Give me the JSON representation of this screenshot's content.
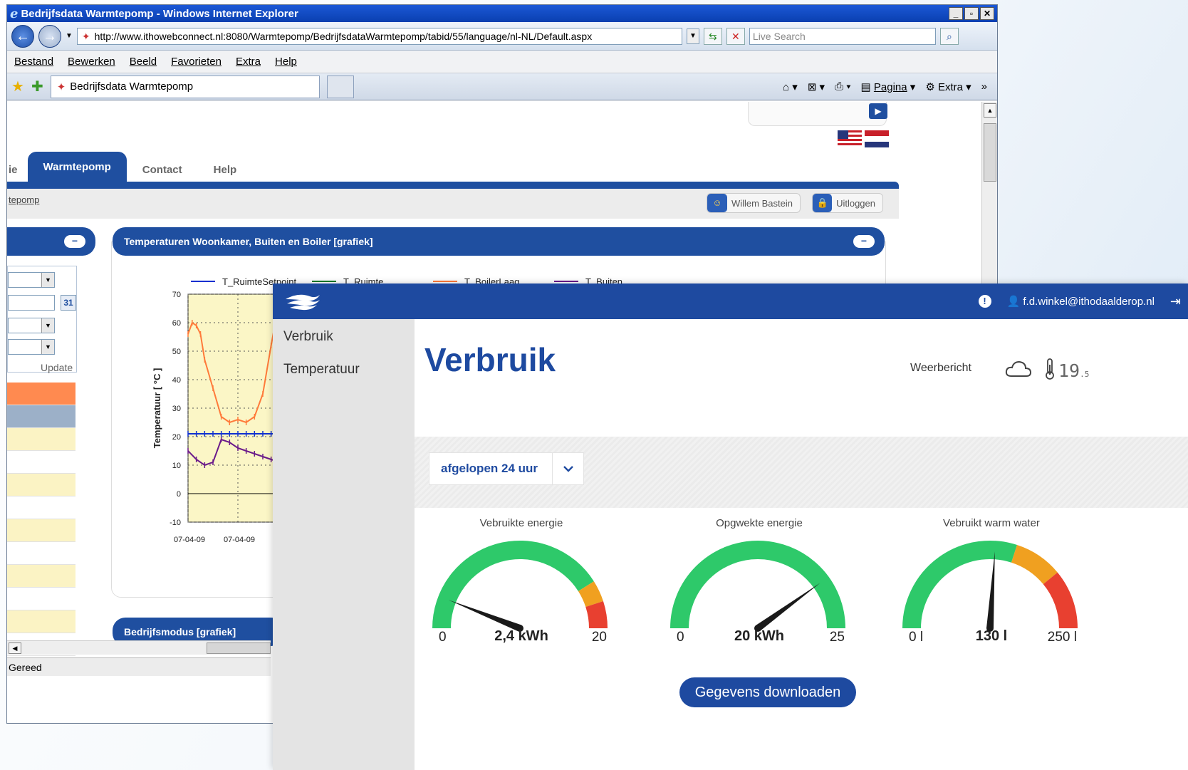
{
  "ie": {
    "title": "Bedrijfsdata Warmtepomp - Windows Internet Explorer",
    "url": "http://www.ithowebconnect.nl:8080/Warmtepomp/BedrijfsdataWarmtepomp/tabid/55/language/nl-NL/Default.aspx",
    "search_placeholder": "Live Search",
    "menu": [
      "Bestand",
      "Bewerken",
      "Beeld",
      "Favorieten",
      "Extra",
      "Help"
    ],
    "tab_title": "Bedrijfsdata Warmtepomp",
    "tools": {
      "page": "Pagina",
      "extra": "Extra"
    },
    "status": "Gereed"
  },
  "old_site": {
    "tabs": {
      "partial": "ie",
      "active": "Warmtepomp",
      "contact": "Contact",
      "help": "Help"
    },
    "breadcrumb": "tepomp",
    "user": "Willem Bastein",
    "logout": "Uitloggen",
    "panel_title": "Temperaturen Woonkamer, Buiten en Boiler [grafiek]",
    "panel2_title": "Bedrijfsmodus [grafiek]",
    "update": "Update",
    "cal_day": "31",
    "table_row_colors": [
      "#ff8a50",
      "#9cb0c8",
      "#fbf3c4",
      "#ffffff",
      "#fbf3c4",
      "#ffffff",
      "#fbf3c4",
      "#ffffff",
      "#fbf3c4",
      "#ffffff",
      "#fbf3c4",
      "#ffffff"
    ]
  },
  "chart_data": {
    "type": "line",
    "title": "",
    "ylabel": "Temperatuur [ °C ]",
    "xlabel": "",
    "ylim": [
      -10,
      70
    ],
    "yticks": [
      70,
      60,
      50,
      40,
      30,
      20,
      10,
      0,
      -10
    ],
    "xtick_labels": [
      "07-04-09",
      "07-04-09"
    ],
    "plot_bg": "#fbf6c6",
    "grid": "dotted",
    "legend": [
      "T_RuimteSetpoint",
      "T_Ruimte",
      "T_BoilerLaag",
      "T_Buiten"
    ],
    "series": [
      {
        "name": "T_RuimteSetpoint",
        "color": "#1030d0",
        "x": [
          0,
          1,
          2,
          3,
          4,
          5,
          6,
          7,
          8,
          9,
          10,
          11,
          12
        ],
        "y": [
          21,
          21,
          21,
          21,
          21,
          21,
          21,
          21,
          21,
          21,
          21,
          21,
          21
        ]
      },
      {
        "name": "T_BoilerLaag",
        "color": "#ff7a3a",
        "x": [
          0,
          0.5,
          1,
          1.5,
          2,
          3,
          4,
          5,
          6,
          7,
          8,
          9,
          10,
          10.5,
          11,
          11.5,
          12
        ],
        "y": [
          56,
          60,
          59,
          56,
          47,
          37,
          27,
          25,
          26,
          25,
          27,
          35,
          52,
          60,
          61,
          61,
          60
        ]
      },
      {
        "name": "T_Buiten",
        "color": "#6a1a8a",
        "x": [
          0,
          1,
          2,
          3,
          4,
          5,
          6,
          7,
          8,
          9,
          10,
          11,
          12
        ],
        "y": [
          15,
          12,
          10,
          11,
          19,
          18,
          16,
          15,
          14,
          13,
          12,
          11,
          10
        ]
      }
    ]
  },
  "app": {
    "user_email": "f.d.winkel@ithodaalderop.nl",
    "nav": [
      "Verbruik",
      "Temperatuur"
    ],
    "title": "Verbruik",
    "weather_label": "Weerbericht",
    "temp_main": "19",
    "temp_dec": ".5",
    "period": "afgelopen 24 uur",
    "gauges": [
      {
        "title": "Vebruikte energie",
        "min": "0",
        "max": "20",
        "value_label": "2,4 kWh",
        "value": 2.4,
        "max_value": 20,
        "zones": [
          [
            0,
            0.82,
            "#2ec96a"
          ],
          [
            0.82,
            0.9,
            "#f0a020"
          ],
          [
            0.9,
            1,
            "#e84030"
          ]
        ]
      },
      {
        "title": "Opgwekte energie",
        "min": "0",
        "max": "25",
        "value_label": "20 kWh",
        "value": 20,
        "max_value": 25,
        "zones": [
          [
            0,
            1,
            "#2ec96a"
          ]
        ]
      },
      {
        "title": "Vebruikt warm water",
        "min": "0 l",
        "max": "250 l",
        "value_label": "130 l",
        "value": 130,
        "max_value": 250,
        "zones": [
          [
            0,
            0.6,
            "#2ec96a"
          ],
          [
            0.6,
            0.78,
            "#f0a020"
          ],
          [
            0.78,
            1,
            "#e84030"
          ]
        ]
      }
    ],
    "download": "Gegevens downloaden"
  }
}
